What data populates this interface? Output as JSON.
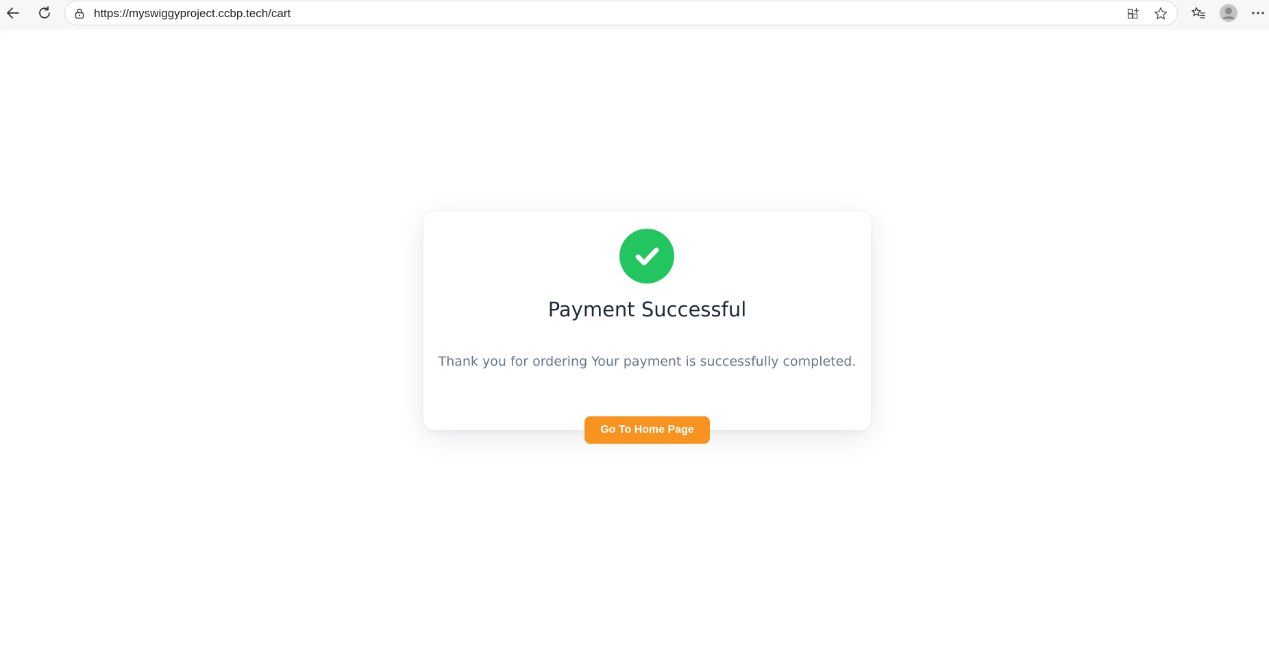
{
  "browser": {
    "url": "https://myswiggyproject.ccbp.tech/cart",
    "icons": {
      "back": "arrow-left-icon",
      "reload": "reload-icon",
      "lock": "lock-icon",
      "apps": "add-app-icon",
      "star": "star-icon",
      "favorites": "favorites-icon",
      "profile": "profile-avatar",
      "more": "more-icon"
    }
  },
  "card": {
    "title": "Payment Successful",
    "message": "Thank you for ordering Your payment is successfully completed.",
    "button_label": "Go To Home Page"
  },
  "colors": {
    "success_green": "#22c55e",
    "accent_orange": "#f7931e",
    "title_text": "#1e293b",
    "message_text": "#64748b"
  }
}
